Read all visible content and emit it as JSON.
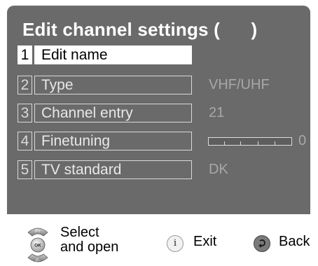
{
  "header": {
    "title": "Edit channel settings (      )"
  },
  "menu": {
    "items": [
      {
        "num": "1",
        "label": "Edit name",
        "value": ""
      },
      {
        "num": "2",
        "label": "Type",
        "value": "VHF/UHF"
      },
      {
        "num": "3",
        "label": "Channel entry",
        "value": "21"
      },
      {
        "num": "4",
        "label": "Finetuning",
        "value": "0"
      },
      {
        "num": "5",
        "label": "TV standard",
        "value": "DK"
      }
    ]
  },
  "footer": {
    "select_line1": "Select",
    "select_line2": "and open",
    "nav_up": "P+",
    "nav_ok": "OK",
    "nav_down": "P-",
    "info_glyph": "i",
    "exit_label": "Exit",
    "back_label": "Back"
  },
  "colors": {
    "panel_bg": "#6a6a6a",
    "highlight": "#ffffff",
    "value_text": "#a8a8a8"
  }
}
